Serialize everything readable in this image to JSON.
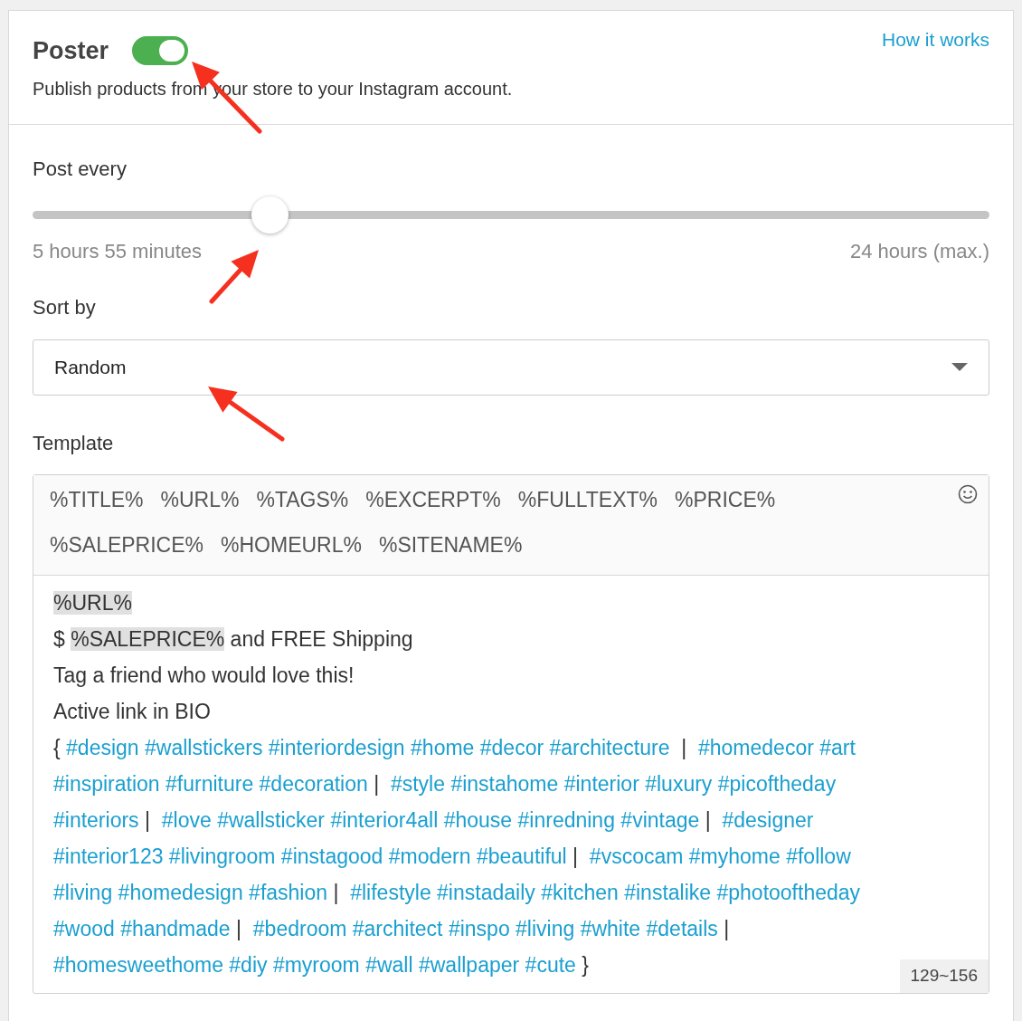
{
  "header": {
    "title": "Poster",
    "enabled": true,
    "description": "Publish products from your store to your Instagram account.",
    "help_link": "How it works"
  },
  "post_every": {
    "label": "Post every",
    "level": 0.248,
    "value": "5 hours 55 minutes",
    "max": "24 hours (max.)"
  },
  "sort_by": {
    "label": "Sort by",
    "value": "Random"
  },
  "template": {
    "label": "Template",
    "tokens": [
      "%TITLE%",
      "%URL%",
      "%TAGS%",
      "%EXCERPT%",
      "%FULLTEXT%",
      "%PRICE%",
      "%SALEPRICE%",
      "%HOMEURL%",
      "%SITENAME%"
    ],
    "lines": [
      [
        {
          "kind": "token",
          "text": "%URL%"
        }
      ],
      [
        {
          "kind": "text",
          "text": "$ "
        },
        {
          "kind": "token",
          "text": "%SALEPRICE%"
        },
        {
          "kind": "text",
          "text": " and FREE Shipping"
        }
      ],
      [
        {
          "kind": "text",
          "text": "Tag a friend who would love this!"
        }
      ],
      [
        {
          "kind": "text",
          "text": "Active link in BIO"
        }
      ],
      [
        {
          "kind": "text",
          "text": "{ "
        },
        {
          "kind": "tag",
          "text": "#design #wallstickers #interiordesign #home #decor #architecture"
        },
        {
          "kind": "text",
          "text": "  |  "
        },
        {
          "kind": "tag",
          "text": "#homedecor #art"
        }
      ],
      [
        {
          "kind": "tag",
          "text": "#inspiration #furniture #decoration"
        },
        {
          "kind": "text",
          "text": " |  "
        },
        {
          "kind": "tag",
          "text": "#style #instahome #interior #luxury #picoftheday"
        }
      ],
      [
        {
          "kind": "tag",
          "text": "#interiors"
        },
        {
          "kind": "text",
          "text": " |  "
        },
        {
          "kind": "tag",
          "text": "#love #wallsticker #interior4all #house #inredning #vintage"
        },
        {
          "kind": "text",
          "text": " |  "
        },
        {
          "kind": "tag",
          "text": "#designer"
        }
      ],
      [
        {
          "kind": "tag",
          "text": "#interior123 #livingroom #instagood #modern #beautiful"
        },
        {
          "kind": "text",
          "text": " |  "
        },
        {
          "kind": "tag",
          "text": "#vscocam #myhome #follow"
        }
      ],
      [
        {
          "kind": "tag",
          "text": "#living #homedesign #fashion"
        },
        {
          "kind": "text",
          "text": " |  "
        },
        {
          "kind": "tag",
          "text": "#lifestyle #instadaily #kitchen #instalike #photooftheday"
        }
      ],
      [
        {
          "kind": "tag",
          "text": "#wood #handmade"
        },
        {
          "kind": "text",
          "text": " |  "
        },
        {
          "kind": "tag",
          "text": "#bedroom #architect #inspo #living #white #details"
        },
        {
          "kind": "text",
          "text": " |"
        }
      ],
      [
        {
          "kind": "tag",
          "text": "#homesweethome #diy #myroom #wall #wallpaper #cute"
        },
        {
          "kind": "text",
          "text": " }"
        }
      ]
    ],
    "counter": "129~156"
  }
}
